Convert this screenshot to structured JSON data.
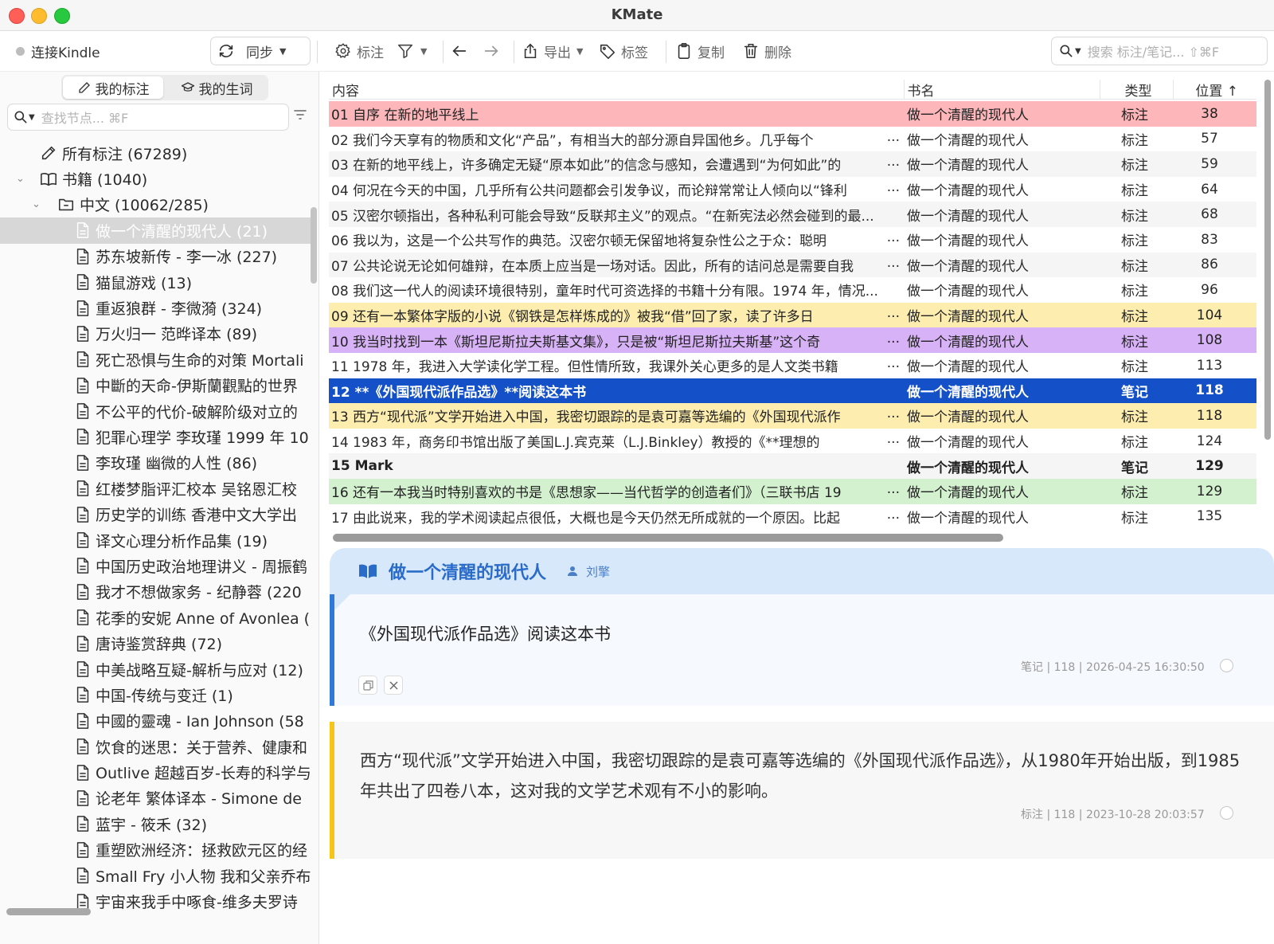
{
  "window": {
    "title": "KMate"
  },
  "toolbar": {
    "connect_label": "连接Kindle",
    "sync_label": "同步",
    "annotate_label": "标注",
    "export_label": "导出",
    "tag_label": "标签",
    "copy_label": "复制",
    "delete_label": "删除",
    "search_placeholder": "搜索 标注/笔记... ⇧⌘F"
  },
  "sidebar": {
    "tabs": [
      {
        "label": "我的标注"
      },
      {
        "label": "我的生词"
      }
    ],
    "search_placeholder": "查找节点... ⌘F",
    "tree": [
      {
        "label": "所有标注 (67289)",
        "icon": "edit-icon",
        "level": 1,
        "selected": false
      },
      {
        "label": "书籍 (1040)",
        "icon": "book-icon",
        "level": 1,
        "selected": false,
        "expanded": true
      },
      {
        "label": "中文 (10062/285)",
        "icon": "folder-icon",
        "level": 2,
        "selected": false,
        "expanded": true
      },
      {
        "label": "做一个清醒的现代人 (21)",
        "icon": "document-icon",
        "level": 3,
        "selected": true
      },
      {
        "label": "苏东坡新传 - 李一冰 (227)",
        "icon": "document-icon",
        "level": 3,
        "selected": false
      },
      {
        "label": "猫鼠游戏 (13)",
        "icon": "document-icon",
        "level": 3,
        "selected": false
      },
      {
        "label": "重返狼群 - 李微漪 (324)",
        "icon": "document-icon",
        "level": 3,
        "selected": false
      },
      {
        "label": "万火归一 范晔译本 (89)",
        "icon": "document-icon",
        "level": 3,
        "selected": false
      },
      {
        "label": "死亡恐惧与生命的对策 Mortali",
        "icon": "document-icon",
        "level": 3,
        "selected": false
      },
      {
        "label": "中斷的天命-伊斯蘭觀點的世界",
        "icon": "document-icon",
        "level": 3,
        "selected": false
      },
      {
        "label": "不公平的代价-破解阶级对立的",
        "icon": "document-icon",
        "level": 3,
        "selected": false
      },
      {
        "label": "犯罪心理学 李玫瑾 1999 年 10",
        "icon": "document-icon",
        "level": 3,
        "selected": false
      },
      {
        "label": "李玫瑾 幽微的人性 (86)",
        "icon": "document-icon",
        "level": 3,
        "selected": false
      },
      {
        "label": "红楼梦脂评汇校本 吴铭恩汇校",
        "icon": "document-icon",
        "level": 3,
        "selected": false
      },
      {
        "label": "历史学的训练 香港中文大学出",
        "icon": "document-icon",
        "level": 3,
        "selected": false
      },
      {
        "label": "译文心理分析作品集 (19)",
        "icon": "document-icon",
        "level": 3,
        "selected": false
      },
      {
        "label": "中国历史政治地理讲义 - 周振鹤",
        "icon": "document-icon",
        "level": 3,
        "selected": false
      },
      {
        "label": "我才不想做家务 - 纪静蓉 (220",
        "icon": "document-icon",
        "level": 3,
        "selected": false
      },
      {
        "label": "花季的安妮 Anne of Avonlea (",
        "icon": "document-icon",
        "level": 3,
        "selected": false
      },
      {
        "label": "唐诗鉴赏辞典 (72)",
        "icon": "document-icon",
        "level": 3,
        "selected": false
      },
      {
        "label": "中美战略互疑-解析与应对 (12)",
        "icon": "document-icon",
        "level": 3,
        "selected": false
      },
      {
        "label": "中国-传统与变迁 (1)",
        "icon": "document-icon",
        "level": 3,
        "selected": false
      },
      {
        "label": "中國的靈魂 - Ian Johnson (58",
        "icon": "document-icon",
        "level": 3,
        "selected": false
      },
      {
        "label": "饮食的迷思：关于营养、健康和",
        "icon": "document-icon",
        "level": 3,
        "selected": false
      },
      {
        "label": "Outlive 超越百岁-长寿的科学与",
        "icon": "document-icon",
        "level": 3,
        "selected": false
      },
      {
        "label": "论老年 繁体译本 - Simone de",
        "icon": "document-icon",
        "level": 3,
        "selected": false
      },
      {
        "label": "蓝宇 - 筱禾 (32)",
        "icon": "document-icon",
        "level": 3,
        "selected": false
      },
      {
        "label": "重塑欧洲经济：拯救欧元区的经",
        "icon": "document-icon",
        "level": 3,
        "selected": false
      },
      {
        "label": "Small Fry 小人物 我和父亲乔布",
        "icon": "document-icon",
        "level": 3,
        "selected": false
      },
      {
        "label": "宇宙来我手中啄食-维多夫罗诗",
        "icon": "document-icon",
        "level": 3,
        "selected": false
      }
    ]
  },
  "table": {
    "columns": {
      "content": "内容",
      "book": "书名",
      "type": "类型",
      "position": "位置 ↑"
    },
    "rows": [
      {
        "content": "01 自序 在新的地平线上",
        "ellipsis": "",
        "book": "做一个清醒的现代人",
        "type": "标注",
        "position": "38",
        "bg": "#fdb6b9",
        "fg": "#222222",
        "bold": false
      },
      {
        "content": "02 我们今天享有的物质和文化“产品”，有相当大的部分源自异国他乡。几乎每个",
        "ellipsis": "...",
        "book": "做一个清醒的现代人",
        "type": "标注",
        "position": "57",
        "bg": "#ffffff",
        "fg": "#2b2b2b",
        "bold": false
      },
      {
        "content": "03 在新的地平线上，许多确定无疑“原本如此”的信念与感知，会遭遇到“为何如此”的",
        "ellipsis": "...",
        "book": "做一个清醒的现代人",
        "type": "标注",
        "position": "59",
        "bg": "#f5f5f5",
        "fg": "#2b2b2b",
        "bold": false
      },
      {
        "content": "04 何况在今天的中国，几乎所有公共问题都会引发争议，而论辩常常让人倾向以“锋利",
        "ellipsis": "...",
        "book": "做一个清醒的现代人",
        "type": "标注",
        "position": "64",
        "bg": "#ffffff",
        "fg": "#2b2b2b",
        "bold": false
      },
      {
        "content": "05 汉密尔顿指出，各种私利可能会导致“反联邦主义”的观点。“在新宪法必然会碰到的最...",
        "ellipsis": "",
        "book": "做一个清醒的现代人",
        "type": "标注",
        "position": "68",
        "bg": "#f5f5f5",
        "fg": "#2b2b2b",
        "bold": false
      },
      {
        "content": "06 我以为，这是一个公共写作的典范。汉密尔顿无保留地将复杂性公之于众：聪明",
        "ellipsis": "...",
        "book": "做一个清醒的现代人",
        "type": "标注",
        "position": "83",
        "bg": "#ffffff",
        "fg": "#2b2b2b",
        "bold": false
      },
      {
        "content": "07 公共论说无论如何雄辩，在本质上应当是一场对话。因此，所有的诘问总是需要自我",
        "ellipsis": "...",
        "book": "做一个清醒的现代人",
        "type": "标注",
        "position": "86",
        "bg": "#f5f5f5",
        "fg": "#2b2b2b",
        "bold": false
      },
      {
        "content": "08 我们这一代人的阅读环境很特别，童年时代可资选择的书籍十分有限。1974 年，情况...",
        "ellipsis": "",
        "book": "做一个清醒的现代人",
        "type": "标注",
        "position": "96",
        "bg": "#ffffff",
        "fg": "#2b2b2b",
        "bold": false
      },
      {
        "content": "09 还有一本繁体字版的小说《钢铁是怎样炼成的》被我“借”回了家，读了许多日",
        "ellipsis": "...",
        "book": "做一个清醒的现代人",
        "type": "标注",
        "position": "104",
        "bg": "#fdeeb0",
        "fg": "#222222",
        "bold": false
      },
      {
        "content": "10 我当时找到一本《斯坦尼斯拉夫斯基文集》，只是被“斯坦尼斯拉夫斯基”这个奇",
        "ellipsis": "...",
        "book": "做一个清醒的现代人",
        "type": "标注",
        "position": "108",
        "bg": "#d8b2f7",
        "fg": "#222222",
        "bold": false
      },
      {
        "content": "11 1978 年，我进入大学读化学工程。但性情所致，我课外关心更多的是人文类书籍",
        "ellipsis": "...",
        "book": "做一个清醒的现代人",
        "type": "标注",
        "position": "113",
        "bg": "#ffffff",
        "fg": "#2b2b2b",
        "bold": false
      },
      {
        "content": "12 **《外国现代派作品选》**阅读这本书",
        "ellipsis": "",
        "book": "做一个清醒的现代人",
        "type": "笔记",
        "position": "118",
        "bg": "#1451c8",
        "fg": "#ffffff",
        "bold": true
      },
      {
        "content": "13 西方“现代派”文学开始进入中国，我密切跟踪的是袁可嘉等选编的《外国现代派作",
        "ellipsis": "...",
        "book": "做一个清醒的现代人",
        "type": "标注",
        "position": "118",
        "bg": "#fdeeb0",
        "fg": "#222222",
        "bold": false
      },
      {
        "content": "14 1983 年，商务印书馆出版了美国L.J.宾克莱（L.J.Binkley）教授的《**理想的",
        "ellipsis": "...",
        "book": "做一个清醒的现代人",
        "type": "标注",
        "position": "124",
        "bg": "#ffffff",
        "fg": "#2b2b2b",
        "bold": false
      },
      {
        "content": "15 Mark",
        "ellipsis": "",
        "book": "做一个清醒的现代人",
        "type": "笔记",
        "position": "129",
        "bg": "#f5f5f5",
        "fg": "#222222",
        "bold": true
      },
      {
        "content": "16 还有一本我当时特别喜欢的书是《思想家——当代哲学的创造者们》（三联书店 19",
        "ellipsis": "...",
        "book": "做一个清醒的现代人",
        "type": "标注",
        "position": "129",
        "bg": "#d3f1cf",
        "fg": "#222222",
        "bold": false
      },
      {
        "content": "17 由此说来，我的学术阅读起点很低，大概也是今天仍然无所成就的一个原因。比起",
        "ellipsis": "...",
        "book": "做一个清醒的现代人",
        "type": "标注",
        "position": "135",
        "bg": "#ffffff",
        "fg": "#2b2b2b",
        "bold": false
      }
    ]
  },
  "detail": {
    "book_title": "做一个清醒的现代人",
    "author": "刘擎",
    "note": {
      "text": "《外国现代派作品选》阅读这本书",
      "meta": "笔记 | 118 | 2026-04-25 16:30:50"
    },
    "highlight": {
      "text": "西方“现代派”文学开始进入中国，我密切跟踪的是袁可嘉等选编的《外国现代派作品选》，从1980年开始出版，到1985年共出了四卷八本，这对我的文学艺术观有不小的影响。",
      "meta": "标注 | 118 | 2023-10-28 20:03:57"
    }
  },
  "colors": {
    "accent": "#1451c8",
    "note_border": "#2f7ad8",
    "highlight_border": "#f5c518",
    "detail_header": "#d7e8fb"
  }
}
